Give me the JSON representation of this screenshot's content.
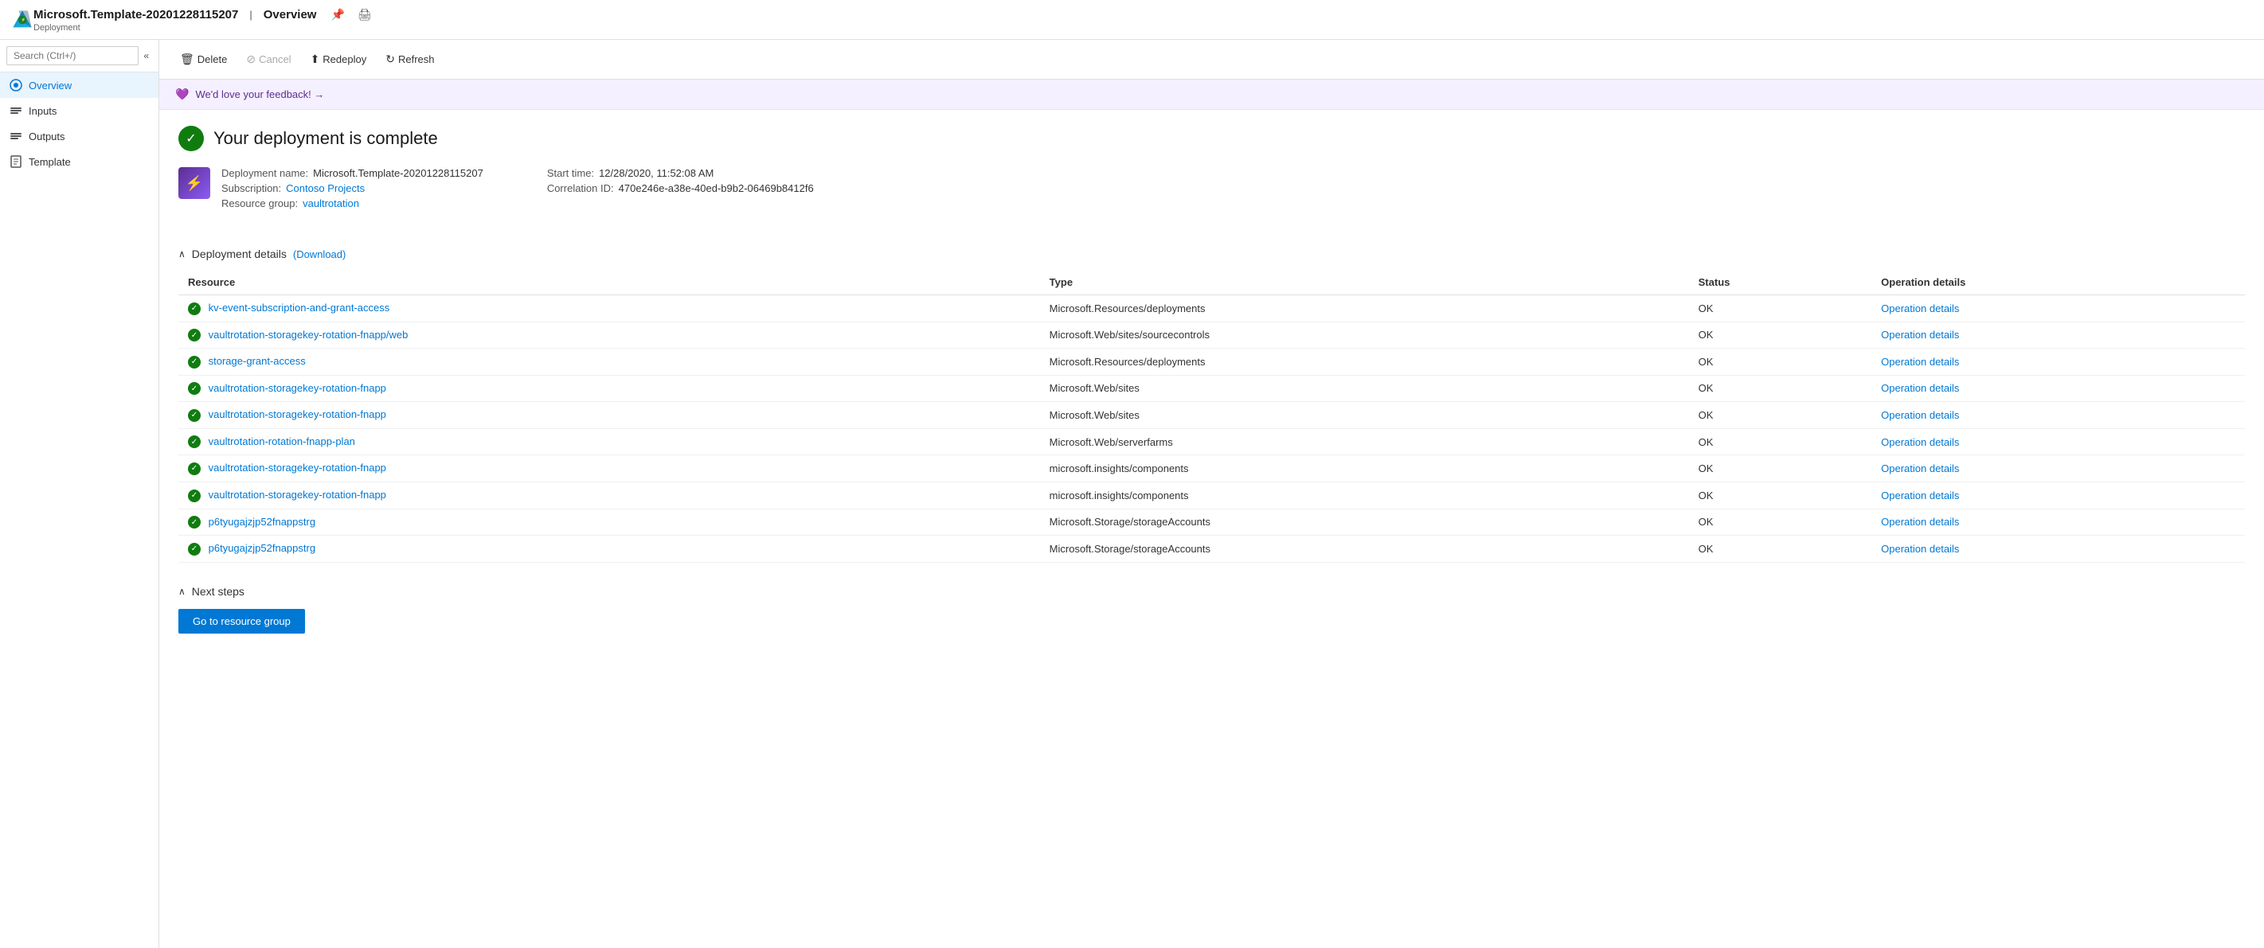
{
  "topbar": {
    "title": "Microsoft.Template-20201228115207",
    "separator": "|",
    "page": "Overview",
    "subtitle": "Deployment",
    "pin_icon": "📌",
    "print_icon": "🖨"
  },
  "toolbar": {
    "delete_label": "Delete",
    "cancel_label": "Cancel",
    "redeploy_label": "Redeploy",
    "refresh_label": "Refresh"
  },
  "feedback": {
    "text": "We'd love your feedback! →"
  },
  "deployment": {
    "complete_title": "Your deployment is complete",
    "name_label": "Deployment name:",
    "name_value": "Microsoft.Template-20201228115207",
    "subscription_label": "Subscription:",
    "subscription_value": "Contoso Projects",
    "resource_group_label": "Resource group:",
    "resource_group_value": "vaultrotation",
    "start_time_label": "Start time:",
    "start_time_value": "12/28/2020, 11:52:08 AM",
    "correlation_label": "Correlation ID:",
    "correlation_value": "470e246e-a38e-40ed-b9b2-06469b8412f6"
  },
  "deployment_details": {
    "section_label": "Deployment details",
    "download_label": "(Download)",
    "columns": {
      "resource": "Resource",
      "type": "Type",
      "status": "Status",
      "operation_details": "Operation details"
    },
    "rows": [
      {
        "resource": "kv-event-subscription-and-grant-access",
        "type": "Microsoft.Resources/deployments",
        "status": "OK",
        "op": "Operation details"
      },
      {
        "resource": "vaultrotation-storagekey-rotation-fnapp/web",
        "type": "Microsoft.Web/sites/sourcecontrols",
        "status": "OK",
        "op": "Operation details"
      },
      {
        "resource": "storage-grant-access",
        "type": "Microsoft.Resources/deployments",
        "status": "OK",
        "op": "Operation details"
      },
      {
        "resource": "vaultrotation-storagekey-rotation-fnapp",
        "type": "Microsoft.Web/sites",
        "status": "OK",
        "op": "Operation details"
      },
      {
        "resource": "vaultrotation-storagekey-rotation-fnapp",
        "type": "Microsoft.Web/sites",
        "status": "OK",
        "op": "Operation details"
      },
      {
        "resource": "vaultrotation-rotation-fnapp-plan",
        "type": "Microsoft.Web/serverfarms",
        "status": "OK",
        "op": "Operation details"
      },
      {
        "resource": "vaultrotation-storagekey-rotation-fnapp",
        "type": "microsoft.insights/components",
        "status": "OK",
        "op": "Operation details"
      },
      {
        "resource": "vaultrotation-storagekey-rotation-fnapp",
        "type": "microsoft.insights/components",
        "status": "OK",
        "op": "Operation details"
      },
      {
        "resource": "p6tyugajzjp52fnappstrg",
        "type": "Microsoft.Storage/storageAccounts",
        "status": "OK",
        "op": "Operation details"
      },
      {
        "resource": "p6tyugajzjp52fnappstrg",
        "type": "Microsoft.Storage/storageAccounts",
        "status": "OK",
        "op": "Operation details"
      }
    ]
  },
  "next_steps": {
    "section_label": "Next steps",
    "go_button_label": "Go to resource group"
  },
  "sidebar": {
    "search_placeholder": "Search (Ctrl+/)",
    "items": [
      {
        "label": "Overview",
        "active": true
      },
      {
        "label": "Inputs",
        "active": false
      },
      {
        "label": "Outputs",
        "active": false
      },
      {
        "label": "Template",
        "active": false
      }
    ]
  }
}
